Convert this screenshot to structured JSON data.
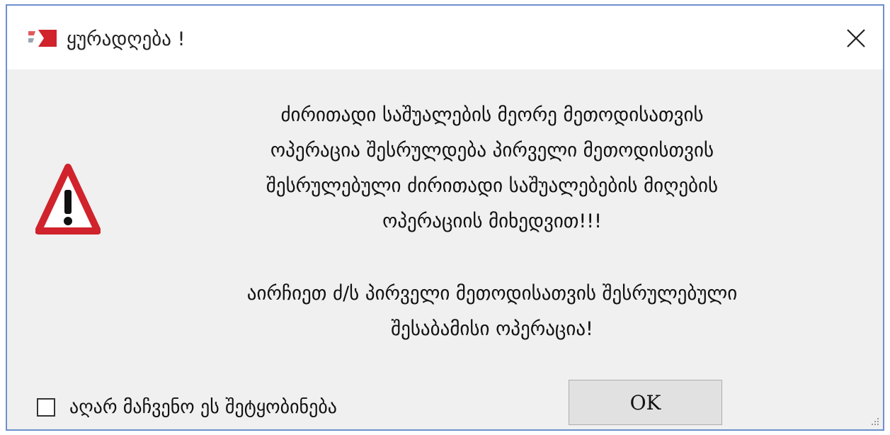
{
  "window": {
    "title": "ყურადღება !",
    "icon": "app-logo-icon",
    "close_icon": "close-icon"
  },
  "message": {
    "icon": "warning-triangle-icon",
    "paragraph_1": "ძირითადი საშუალების მეორე მეთოდისათვის\nოპერაცია შესრულდება პირველი მეთოდისთვის\nშესრულებული ძირითადი საშუალებების მიღების\nოპერაციის მიხედვით!!!",
    "paragraph_2": "აირჩიეთ ძ/ს პირველი მეთოდისათვის შესრულებული\nშესაბამისი ოპერაცია!"
  },
  "dont_show": {
    "label": "აღარ მაჩვენო ეს შეტყობინება",
    "checked": false
  },
  "buttons": {
    "ok_label": "OK"
  },
  "colors": {
    "frame_border": "#6d8fcd",
    "dialog_background": "#f0f0f0",
    "warning_red": "#d0232b",
    "button_face": "#e1e1e1"
  }
}
